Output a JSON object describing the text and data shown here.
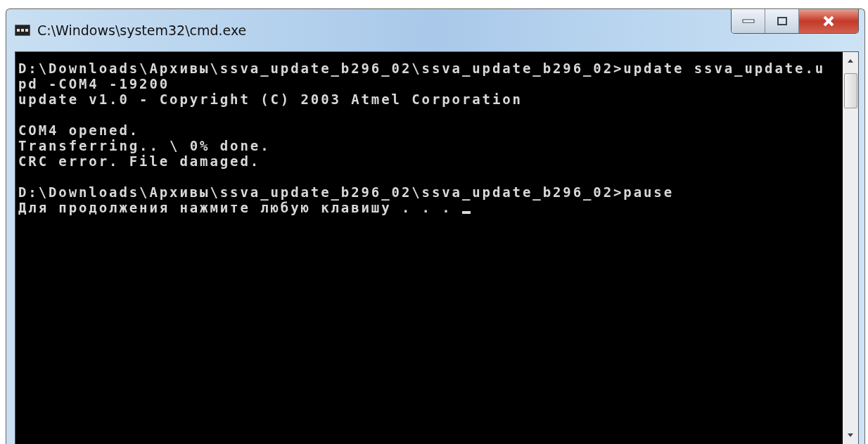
{
  "window": {
    "title": "C:\\Windows\\system32\\cmd.exe"
  },
  "console": {
    "blocks": [
      [
        "D:\\Downloads\\Архивы\\ssva_update_b296_02\\ssva_update_b296_02>update ssva_update.u",
        "pd -COM4 -19200",
        "update v1.0 - Copyright (C) 2003 Atmel Corporation"
      ],
      [
        "COM4 opened.",
        "Transferring.. \\ 0% done.",
        "CRC error. File damaged."
      ],
      [
        "D:\\Downloads\\Архивы\\ssva_update_b296_02\\ssva_update_b296_02>pause",
        "Для продолжения нажмите любую клавишу . . . "
      ]
    ]
  }
}
